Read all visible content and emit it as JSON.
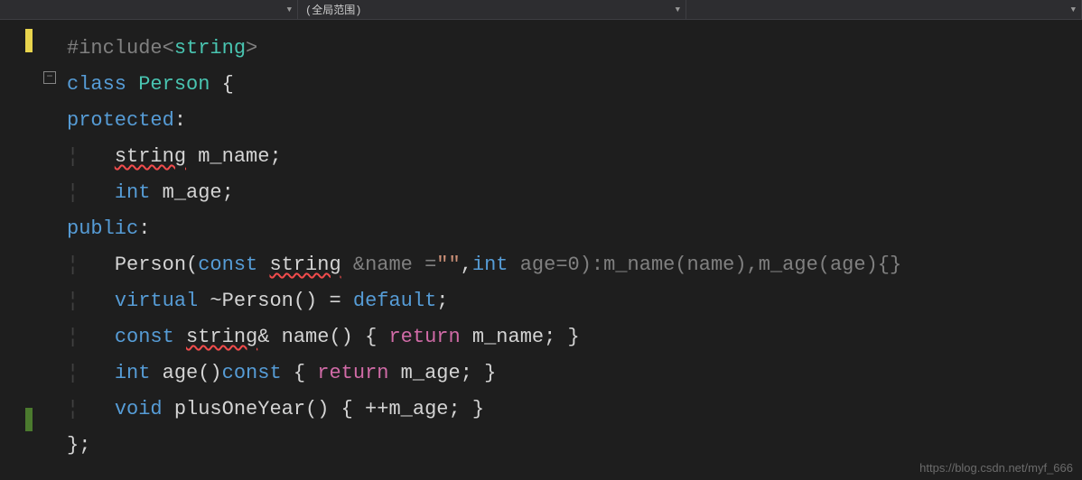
{
  "topbar": {
    "scope_label": "(全局范围)"
  },
  "code": {
    "include_pre": "#include<",
    "string_kw": "string",
    "include_post": ">",
    "class_kw": "class",
    "person_type": "Person",
    "brace_open": " {",
    "protected_kw": "protected",
    "colon": ":",
    "m_name_type": "string",
    "m_name_id": " m_name;",
    "int_kw": "int",
    "m_age_id": " m_age;",
    "public_kw": "public",
    "ctor_name": "Person",
    "paren_open": "(",
    "const_kw": "const",
    "ctor_string": "string",
    "amp_name": " &name =",
    "empty_str": "\"\"",
    "comma1": ",",
    "age_param": " age=0):m_name(name),m_age(age){}",
    "virtual_kw": "virtual",
    "dtor": " ~Person() = ",
    "default_kw": "default",
    "semicolon": ";",
    "name_ret_const": "const",
    "name_ret_string": "string",
    "name_ret_amp": "& name() { ",
    "return_kw": "return",
    "ret_mname": " m_name; }",
    "age_int": "int",
    "age_sig": " age()",
    "age_const": "const",
    "age_body": " { ",
    "ret_mage": " m_age; }",
    "void_kw": "void",
    "plusone": " plusOneYear() { ++m_age; }",
    "close": "};"
  },
  "watermark": "https://blog.csdn.net/myf_666"
}
